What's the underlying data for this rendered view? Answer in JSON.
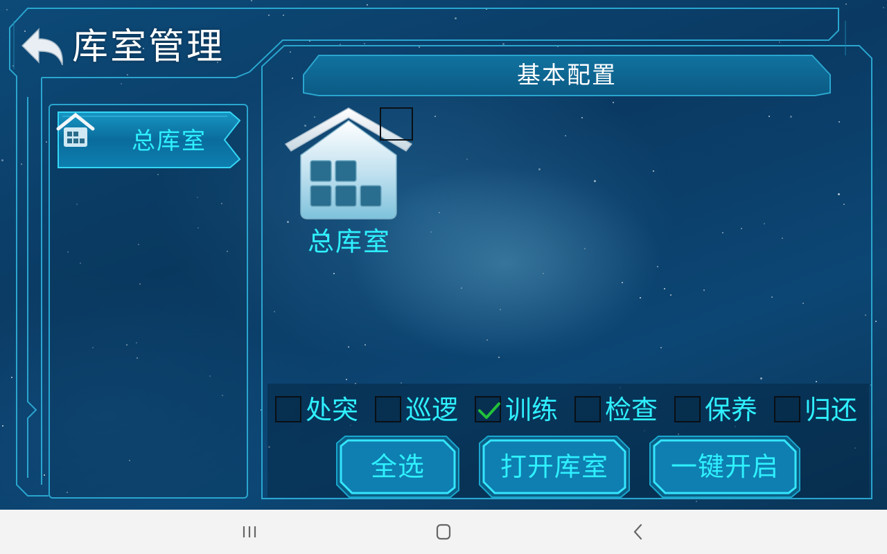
{
  "header": {
    "title": "库室管理",
    "back_icon": "back-arrow-icon"
  },
  "sidebar": {
    "items": [
      {
        "label": "总库室",
        "icon": "warehouse-icon",
        "selected": true
      }
    ]
  },
  "main": {
    "section_title": "基本配置",
    "rooms": [
      {
        "label": "总库室",
        "icon": "warehouse-icon",
        "checked": false
      }
    ],
    "options": [
      {
        "label": "处突",
        "checked": false
      },
      {
        "label": "巡逻",
        "checked": false
      },
      {
        "label": "训练",
        "checked": true
      },
      {
        "label": "检查",
        "checked": false
      },
      {
        "label": "保养",
        "checked": false
      },
      {
        "label": "归还",
        "checked": false
      }
    ],
    "buttons": {
      "select_all": "全选",
      "open_room": "打开库室",
      "one_key_open": "一键开启"
    }
  },
  "nav_bar": {
    "recents_icon": "recents-icon",
    "home_icon": "home-icon",
    "back_icon": "back-chevron-icon"
  },
  "colors": {
    "accent_cyan": "#2ff0ff",
    "frame_blue": "#2aa6cf",
    "check_green": "#22c13a"
  }
}
